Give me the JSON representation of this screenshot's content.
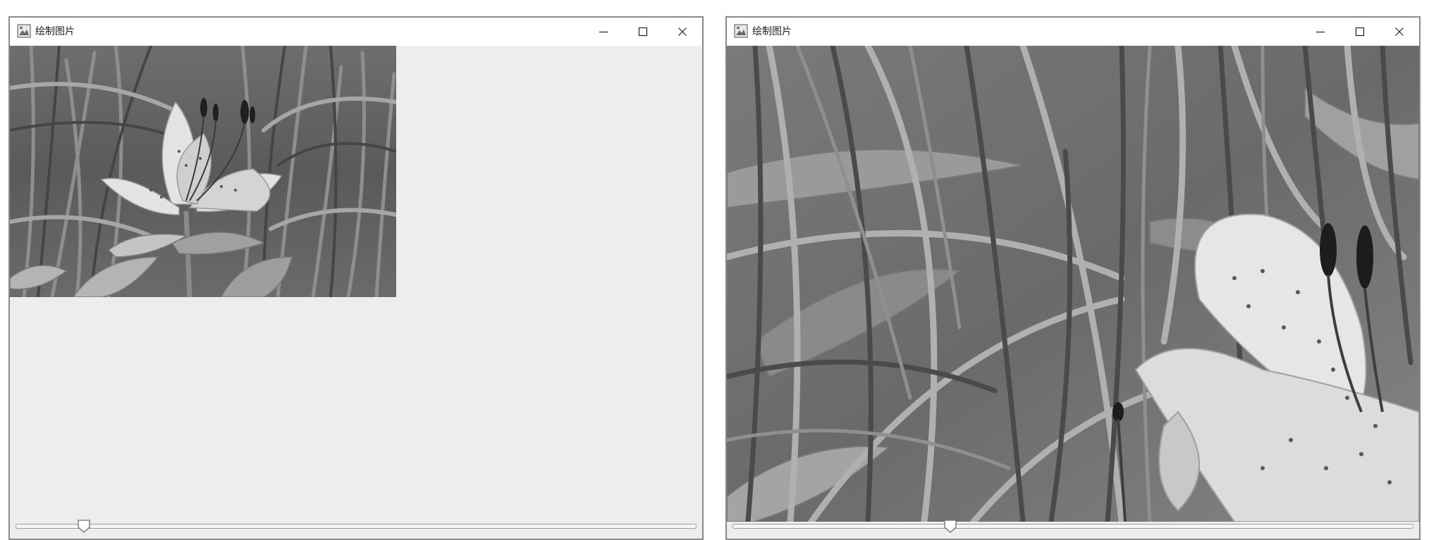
{
  "windows": [
    {
      "title": "绘制图片",
      "app_icon": "java-app-icon",
      "controls": {
        "minimize_icon": "minimize-icon",
        "maximize_icon": "maximize-icon",
        "close_icon": "close-icon"
      },
      "image": {
        "description_icon": "lily-photo",
        "zoom_level": 0.55
      },
      "slider": {
        "value_fraction": 0.1
      }
    },
    {
      "title": "绘制图片",
      "app_icon": "java-app-icon",
      "controls": {
        "minimize_icon": "minimize-icon",
        "maximize_icon": "maximize-icon",
        "close_icon": "close-icon"
      },
      "image": {
        "description_icon": "lily-photo",
        "zoom_level": 1.9
      },
      "slider": {
        "value_fraction": 0.32
      }
    }
  ],
  "colors": {
    "window_bg": "#ededed",
    "titlebar_bg": "#ffffff",
    "border": "#8a8a8a",
    "foliage_dark": "#4a4a4a",
    "foliage_mid": "#7a7a7a",
    "foliage_light": "#a8a8a8",
    "petal": "#e4e4e4",
    "stamen": "#1e1e1e"
  }
}
